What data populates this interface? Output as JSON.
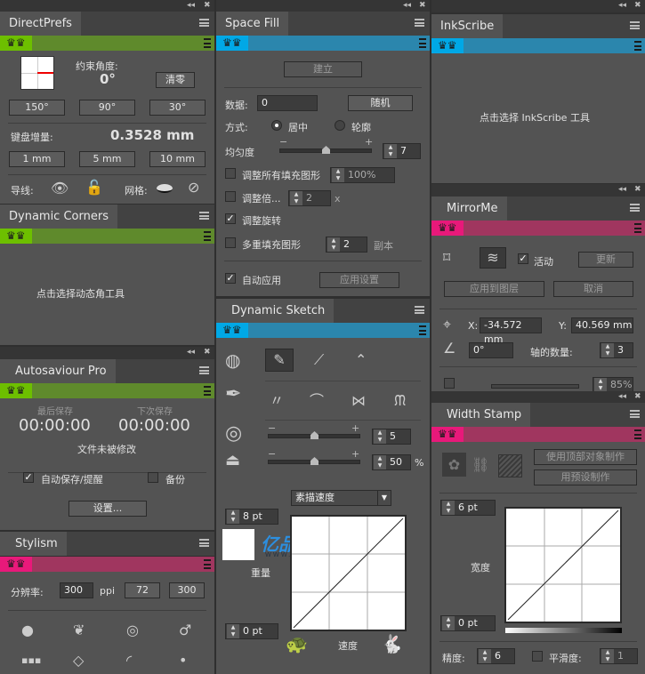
{
  "colors": {
    "green": "#6dbf00",
    "green_bar": "#5f8a2c",
    "blue": "#00a8e6",
    "blue_bar": "#2b86ad",
    "pink": "#e8197a",
    "pink_bar": "#a0365f"
  },
  "direct_prefs": {
    "title": "DirectPrefs",
    "angle_label": "约束角度:",
    "angle_value": "0°",
    "clear": "清零",
    "angles": [
      "150°",
      "90°",
      "30°"
    ],
    "increment_label": "键盘增量:",
    "increment_value": "0.3528 mm",
    "increments": [
      "1 mm",
      "5 mm",
      "10 mm"
    ],
    "guides_label": "导线:",
    "grid_label": "网格:"
  },
  "dynamic_corners": {
    "title": "Dynamic Corners",
    "hint": "点击选择动态角工具"
  },
  "autosaviour": {
    "title": "Autosaviour Pro",
    "last_label": "最后保存",
    "next_label": "下次保存",
    "last_time": "00:00:00",
    "next_time": "00:00:00",
    "status": "文件未被修改",
    "auto_save": "自动保存/提醒",
    "backup": "备份",
    "settings": "设置..."
  },
  "stylism": {
    "title": "Stylism",
    "res_label": "分辨率:",
    "res_value": "300",
    "unit": "ppi",
    "preset1": "72",
    "preset2": "300"
  },
  "space_fill": {
    "title": "Space Fill",
    "create": "建立",
    "data_label": "数据:",
    "data_value": "0",
    "random": "随机",
    "mode_label": "方式:",
    "mode_center": "居中",
    "mode_outline": "轮廓",
    "uniform_label": "均匀度",
    "minus": "−",
    "plus": "+",
    "uniform_value": "7",
    "uniform_fraction": 0.5,
    "adjust_all": "调整所有填充图形",
    "adjust_all_value": "100%",
    "adjust_scale": "调整倍...",
    "adjust_scale_value": "2",
    "x": "x",
    "adjust_rotate": "调整旋转",
    "multi_fill": "多重填充图形",
    "multi_value": "2",
    "copies": "副本",
    "auto_apply": "自动应用",
    "apply_settings": "应用设置"
  },
  "dynamic_sketch": {
    "title": "Dynamic Sketch",
    "minus": "−",
    "plus": "+",
    "value1": "5",
    "value1_fraction": 0.5,
    "value2": "50",
    "value2_fraction": 0.5,
    "percent": "%",
    "dropdown": "素描速度",
    "max_pt": "8 pt",
    "min_pt": "0 pt",
    "weight_label": "重量",
    "speed_label": "速度",
    "watermark": "亿品元素",
    "watermark_url": "WWW.EPINV.COM"
  },
  "inkscribe": {
    "title": "InkScribe",
    "hint": "点击选择 InkScribe 工具"
  },
  "mirrorme": {
    "title": "MirrorMe",
    "active": "活动",
    "update": "更新",
    "apply_layer": "应用到图层",
    "cancel": "取消",
    "x_label": "X:",
    "x_value": "-34.572 mm",
    "y_label": "Y:",
    "y_value": "40.569 mm",
    "angle_value": "0°",
    "axes_label": "轴的数量:",
    "axes_value": "3",
    "opacity": "85%"
  },
  "width_stamp": {
    "title": "Width Stamp",
    "use_top": "使用顶部对象制作",
    "use_preset": "用预设制作",
    "max_pt": "6 pt",
    "min_pt": "0 pt",
    "width_label": "宽度",
    "precision_label": "精度:",
    "precision_value": "6",
    "smooth_label": "平滑度:",
    "smooth_value": "1"
  }
}
